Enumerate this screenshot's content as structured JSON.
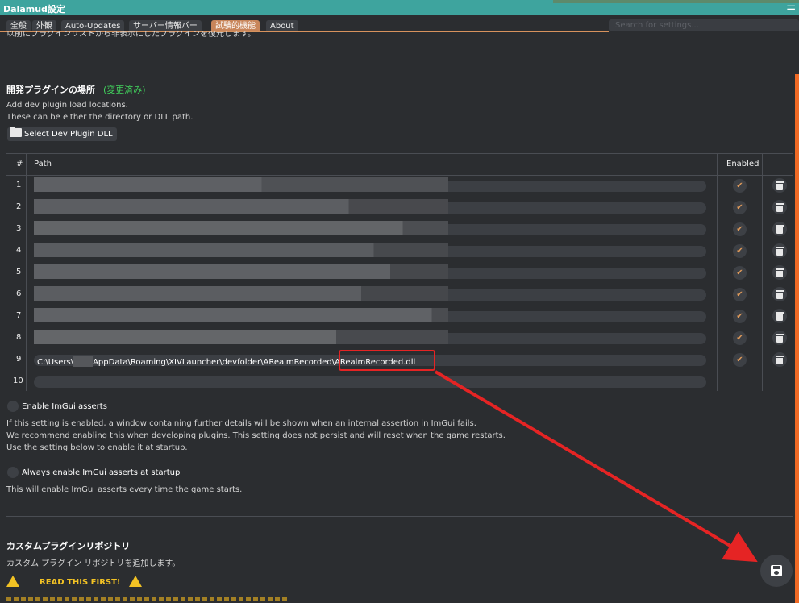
{
  "window": {
    "title": "Dalamud設定"
  },
  "tabs": [
    {
      "label": "全般",
      "active": false
    },
    {
      "label": "外観",
      "active": false
    },
    {
      "label": "Auto-Updates",
      "active": false
    },
    {
      "label": "サーバー情報バー",
      "active": false
    },
    {
      "label": "試験的機能",
      "active": true
    },
    {
      "label": "About",
      "active": false
    }
  ],
  "search": {
    "placeholder": "Search for settings..."
  },
  "section_dev": {
    "title": "開発プラグインの場所",
    "changed": "(変更済み)",
    "desc_line1": "Add dev plugin load locations.",
    "desc_line2": "These can be either the directory or DLL path.",
    "select_button": "Select Dev Plugin DLL"
  },
  "table": {
    "headers": {
      "index": "#",
      "path": "Path",
      "enabled": "Enabled"
    },
    "rows": [
      {
        "index": "1",
        "path": "",
        "enabled": true
      },
      {
        "index": "2",
        "path": "",
        "enabled": true
      },
      {
        "index": "3",
        "path": "",
        "enabled": true
      },
      {
        "index": "4",
        "path": "",
        "enabled": true
      },
      {
        "index": "5",
        "path": "",
        "enabled": true
      },
      {
        "index": "6",
        "path": "",
        "enabled": true
      },
      {
        "index": "7",
        "path": "",
        "enabled": true
      },
      {
        "index": "8",
        "path": "",
        "enabled": true
      },
      {
        "index": "9",
        "path_prefix": "C:\\Users\\",
        "path_middle": "AppData\\Roaming\\XIVLauncher\\devfolder\\ARealmRecorded\\",
        "path_file": "ARealmRecorded.dll",
        "enabled": true
      },
      {
        "index": "10",
        "path": "",
        "enabled": false
      }
    ]
  },
  "imgui_asserts": {
    "label": "Enable ImGui asserts",
    "desc_line1": "If this setting is enabled, a window containing further details will be shown when an internal assertion in ImGui fails.",
    "desc_line2": "We recommend enabling this when developing plugins. This setting does not persist and will reset when the game restarts.",
    "desc_line3": "Use the setting below to enable it at startup."
  },
  "imgui_startup": {
    "label": "Always enable ImGui asserts at startup",
    "desc": "This will enable ImGui asserts every time the game starts."
  },
  "custom_repo": {
    "title": "カスタムプラグインリポジトリ",
    "desc": "カスタム プラグイン リポジトリを追加します。",
    "warning": "READ THIS FIRST!"
  },
  "colors": {
    "accent": "#c8855a",
    "titlebar": "#3ea49e",
    "changed": "#41d35c",
    "warning": "#f2c224",
    "annotation": "#e52424"
  },
  "icons": [
    "menu-icon",
    "folder-icon",
    "check-icon",
    "trash-icon",
    "warning-icon",
    "save-icon"
  ]
}
